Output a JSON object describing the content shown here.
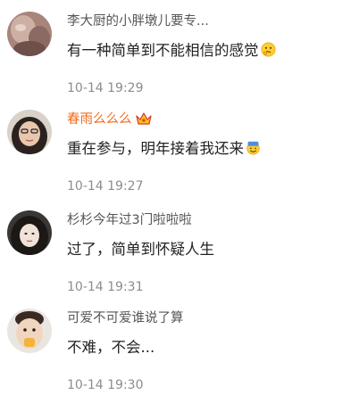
{
  "colors": {
    "username": "#555555",
    "username_vip": "#f26a1b",
    "text": "#222222",
    "time": "#8c8c8c",
    "background": "#ffffff"
  },
  "comments": [
    {
      "username": "李大厨的小胖墩儿要专...",
      "text": "有一种简单到不能相信的感觉",
      "emoji": "thinking-face-emoji",
      "time": "10-14 19:29"
    },
    {
      "username": "春雨么么么",
      "badge": "crown-icon",
      "text": "重在参与，明年接着我还来",
      "emoji": "sweat-smile-emoji",
      "time": "10-14 19:27"
    },
    {
      "username": "杉杉今年过3门啦啦啦",
      "text": "过了，简单到怀疑人生",
      "time": "10-14 19:31"
    },
    {
      "username": "可爱不可爱谁说了算",
      "text": "不难，不会...",
      "time": "10-14 19:30"
    }
  ]
}
